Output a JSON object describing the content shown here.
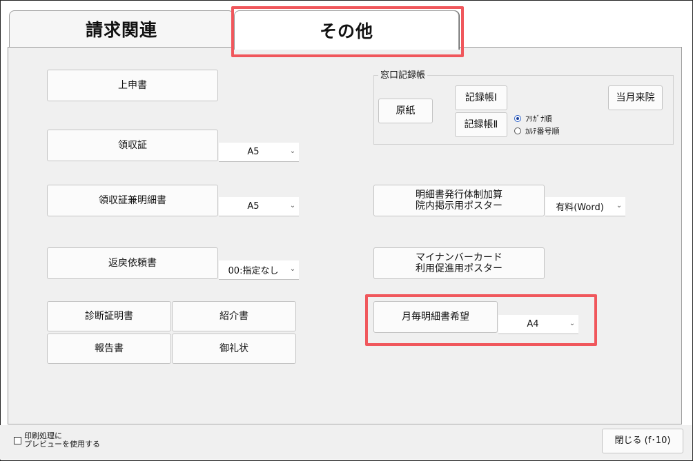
{
  "tabs": {
    "billing": "請求関連",
    "other": "その他"
  },
  "left": {
    "jochusho": "上申書",
    "ryoshusho": "領収証",
    "ryoshusho_size": "A5",
    "ryoshusho_meisai": "領収証兼明細書",
    "ryoshusho_meisai_size": "A5",
    "henrei": "返戻依頼書",
    "henrei_select": "00:指定なし",
    "shindan": "診断証明書",
    "shokai": "紹介書",
    "hokoku": "報告書",
    "onrei": "御礼状"
  },
  "madoguchi": {
    "title": "窓口記録帳",
    "genshi": "原紙",
    "kiroku1": "記録帳Ⅰ",
    "kiroku2": "記録帳Ⅱ",
    "tougetsu": "当月来院",
    "radio_furigana": "ﾌﾘｶﾞﾅ順",
    "radio_karte": "ｶﾙﾃ番号順"
  },
  "right": {
    "meisai_poster_line1": "明細書発行体制加算",
    "meisai_poster_line2": "院内掲示用ポスター",
    "meisai_poster_select": "有料(Word)",
    "myna_line1": "マイナンバーカード",
    "myna_line2": "利用促進用ポスター",
    "maitsuki": "月毎明細書希望",
    "maitsuki_size": "A4"
  },
  "footer": {
    "preview_line1": "印刷処理に",
    "preview_line2": "プレビューを使用する",
    "close": "閉じる (f･10)"
  },
  "colors": {
    "highlight": "#f0575c",
    "panel": "#f0f0f0"
  }
}
